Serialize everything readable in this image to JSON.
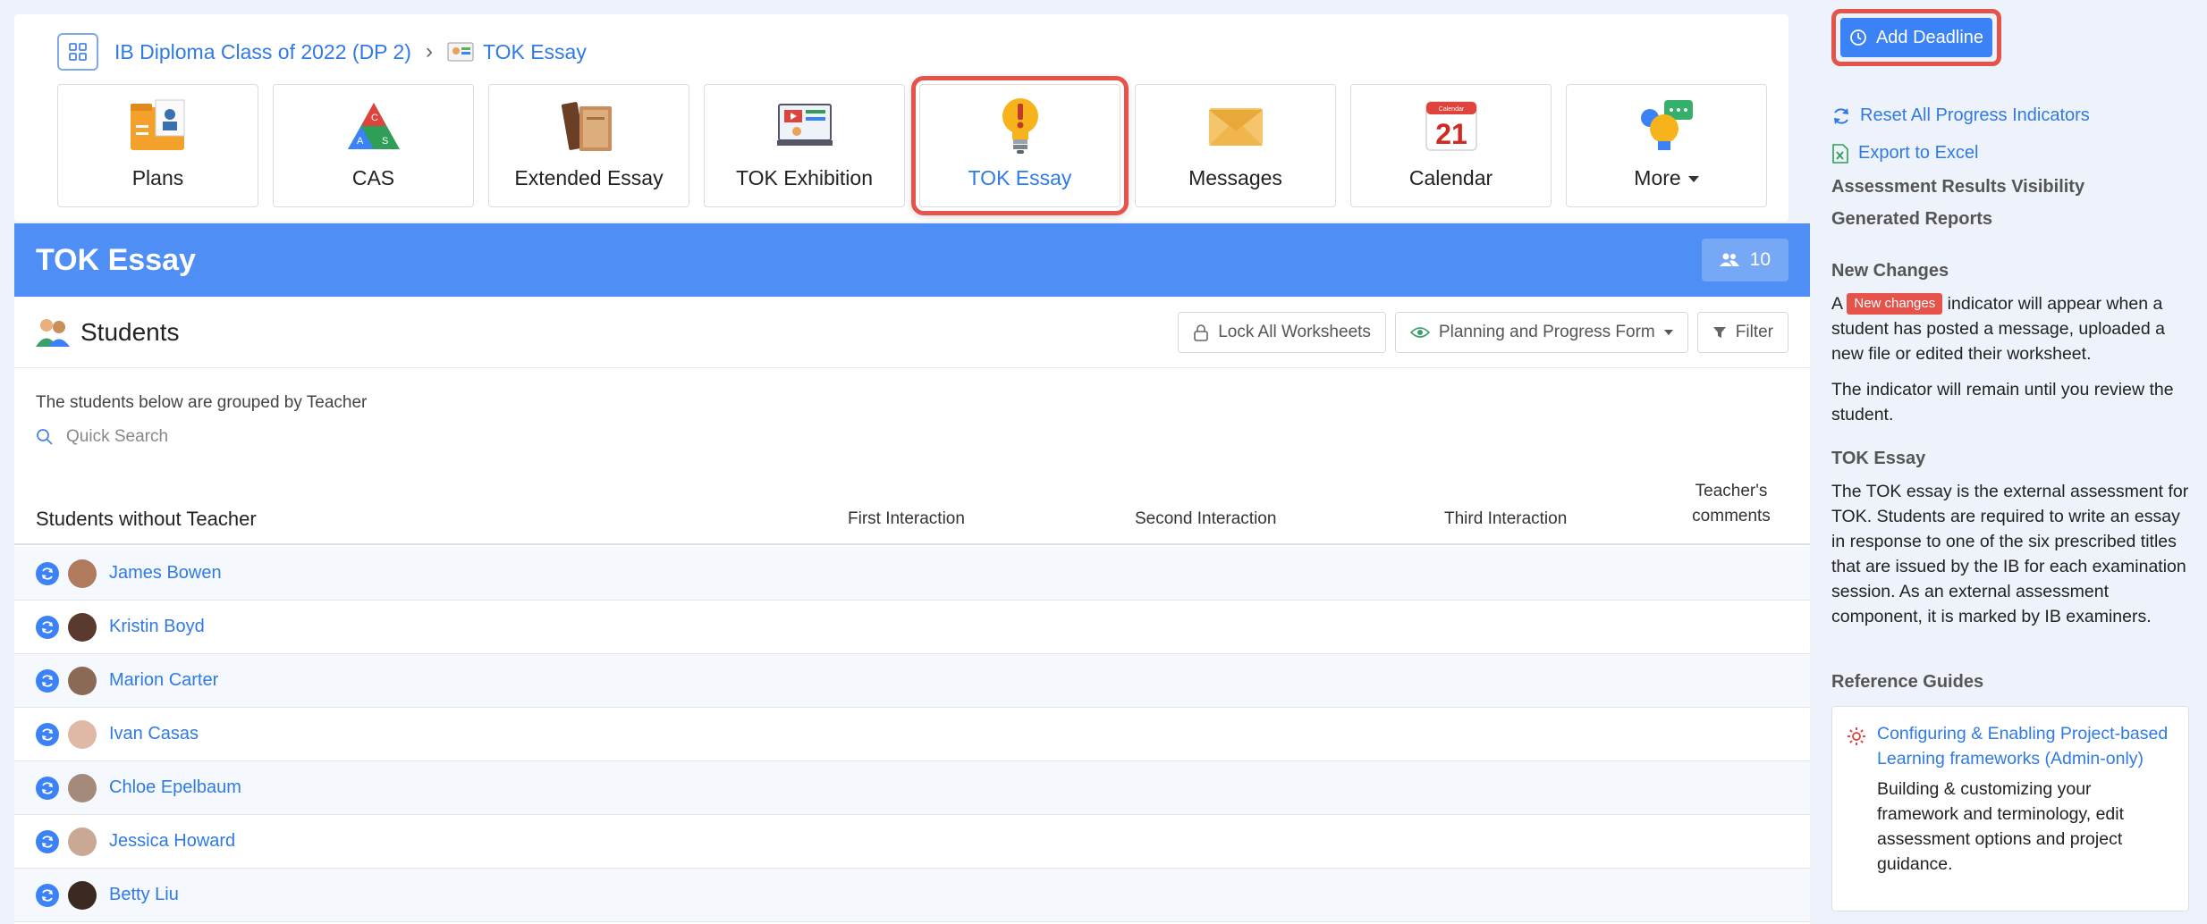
{
  "breadcrumb": {
    "class_label": "IB Diploma Class of 2022 (DP 2)",
    "separator": "›",
    "current": "TOK Essay"
  },
  "tiles": [
    {
      "label": "Plans",
      "icon": "plans-folder-icon"
    },
    {
      "label": "CAS",
      "icon": "cas-triangle-icon"
    },
    {
      "label": "Extended Essay",
      "icon": "books-icon"
    },
    {
      "label": "TOK Exhibition",
      "icon": "exhibition-screen-icon"
    },
    {
      "label": "TOK Essay",
      "icon": "lightbulb-icon",
      "active": true
    },
    {
      "label": "Messages",
      "icon": "envelope-icon"
    },
    {
      "label": "Calendar",
      "icon": "calendar-icon",
      "calendar_day": "21",
      "calendar_month": "Calendar"
    },
    {
      "label": "More",
      "icon": "more-lightbulb-chat-icon"
    }
  ],
  "banner": {
    "title": "TOK Essay",
    "student_count": "10"
  },
  "students_section": {
    "title": "Students",
    "lock_label": "Lock All Worksheets",
    "planning_label": "Planning and Progress Form",
    "filter_label": "Filter",
    "grouped_note": "The students below are grouped by Teacher",
    "search_placeholder": "Quick Search"
  },
  "table": {
    "group_title": "Students without Teacher",
    "columns": [
      "First Interaction",
      "Second Interaction",
      "Third Interaction",
      "Teacher's",
      "comments"
    ],
    "rows": [
      {
        "name": "James Bowen",
        "avatar_color": "#b07a5c"
      },
      {
        "name": "Kristin Boyd",
        "avatar_color": "#5a3a2e"
      },
      {
        "name": "Marion Carter",
        "avatar_color": "#8a6a55"
      },
      {
        "name": "Ivan Casas",
        "avatar_color": "#e0b9a6"
      },
      {
        "name": "Chloe Epelbaum",
        "avatar_color": "#a48a7a"
      },
      {
        "name": "Jessica Howard",
        "avatar_color": "#c9a995"
      },
      {
        "name": "Betty Liu",
        "avatar_color": "#3a2a22"
      }
    ]
  },
  "sidebar": {
    "add_deadline": "Add Deadline",
    "reset_progress": "Reset All Progress Indicators",
    "export_excel": "Export to Excel",
    "assessment_visibility": "Assessment Results Visibility",
    "generated_reports": "Generated Reports",
    "new_changes_heading": "New Changes",
    "new_changes_pre": "A",
    "new_changes_badge": "New changes",
    "new_changes_post": "indicator will appear when a student has posted a message, uploaded a new file or edited their worksheet.",
    "indicator_note": "The indicator will remain until you review the student.",
    "tok_heading": "TOK Essay",
    "tok_text": "The TOK essay is the external assessment for TOK. Students are required to write an essay in response to one of the six prescribed titles that are issued by the IB for each examination session. As an external assessment component, it is marked by IB examiners.",
    "reference_heading": "Reference Guides",
    "guide_title": "Configuring & Enabling Project-based Learning frameworks (Admin-only)",
    "guide_desc": "Building & customizing your framework and terminology, edit assessment options and project guidance."
  },
  "colors": {
    "accent": "#3b82f6",
    "banner": "#4f8ef5",
    "highlight": "#e5534b",
    "link": "#2f7ae5"
  }
}
